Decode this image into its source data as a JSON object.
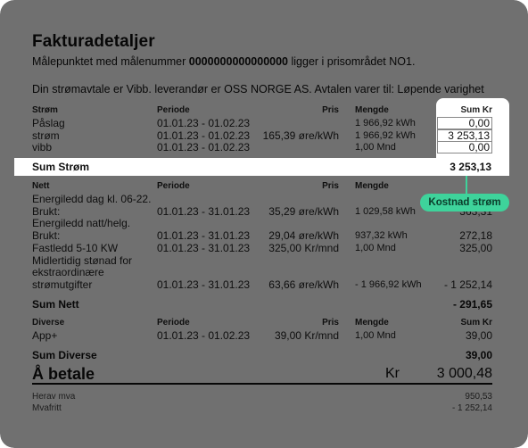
{
  "title": "Fakturadetaljer",
  "meter_line": {
    "prefix": "Målepunktet med målenummer ",
    "number": "0000000000000000",
    "suffix": " ligger i prisområdet NO1."
  },
  "agreement_line": "Din strømavtale er Vibb. leverandør er OSS NORGE AS. Avtalen varer til: Løpende varighet",
  "columns": {
    "periode": "Periode",
    "pris": "Pris",
    "mengde": "Mengde",
    "sum": "Sum Kr"
  },
  "strom": {
    "header": "Strøm",
    "rows": [
      {
        "name": "Påslag",
        "periode": "01.01.23 - 01.02.23",
        "pris": "",
        "mengde": "1 966,92 kWh",
        "sum": "0,00"
      },
      {
        "name": "strøm",
        "periode": "01.01.23 - 01.02.23",
        "pris": "165,39 øre/kWh",
        "mengde": "1 966,92 kWh",
        "sum": "3 253,13"
      },
      {
        "name": "vibb",
        "periode": "01.01.23 - 01.02.23",
        "pris": "",
        "mengde": "1,00 Mnd",
        "sum": "0,00"
      }
    ],
    "sum_label": "Sum Strøm",
    "sum_value": "3 253,13"
  },
  "nett": {
    "header": "Nett",
    "rows": [
      {
        "name1": "Energiledd dag kl. 06-22.",
        "name2": "Brukt:",
        "periode": "01.01.23 - 31.01.23",
        "pris": "35,29 øre/kWh",
        "mengde": "1 029,58 kWh",
        "sum": "363,31"
      },
      {
        "name1": "Energiledd natt/helg.",
        "name2": "Brukt:",
        "periode": "01.01.23 - 31.01.23",
        "pris": "29,04 øre/kWh",
        "mengde": "937,32 kWh",
        "sum": "272,18"
      },
      {
        "name1": "Fastledd 5-10 KW",
        "name2": "",
        "periode": "01.01.23 - 31.01.23",
        "pris": "325,00 Kr/mnd",
        "mengde": "1,00 Mnd",
        "sum": "325,00"
      },
      {
        "name1": "Midlertidig stønad for",
        "name2": "ekstraordinære",
        "name3": "strømutgifter",
        "periode": "01.01.23 - 31.01.23",
        "pris": "63,66 øre/kWh",
        "mengde": "- 1 966,92 kWh",
        "sum": "- 1 252,14"
      }
    ],
    "sum_label": "Sum Nett",
    "sum_value": "- 291,65"
  },
  "diverse": {
    "header": "Diverse",
    "rows": [
      {
        "name": "App+",
        "periode": "01.01.23 - 01.02.23",
        "pris": "39,00 Kr/mnd",
        "mengde": "1,00 Mnd",
        "sum": "39,00"
      }
    ],
    "sum_label": "Sum Diverse",
    "sum_value": "39,00"
  },
  "total": {
    "label": "Å betale",
    "currency": "Kr",
    "value": "3 000,48"
  },
  "footer": [
    {
      "label": "Herav mva",
      "value": "950,53"
    },
    {
      "label": "Mvafritt",
      "value": "- 1 252,14"
    }
  ],
  "callout": {
    "label": "Kostnad strøm",
    "color": "#3ed39b"
  }
}
